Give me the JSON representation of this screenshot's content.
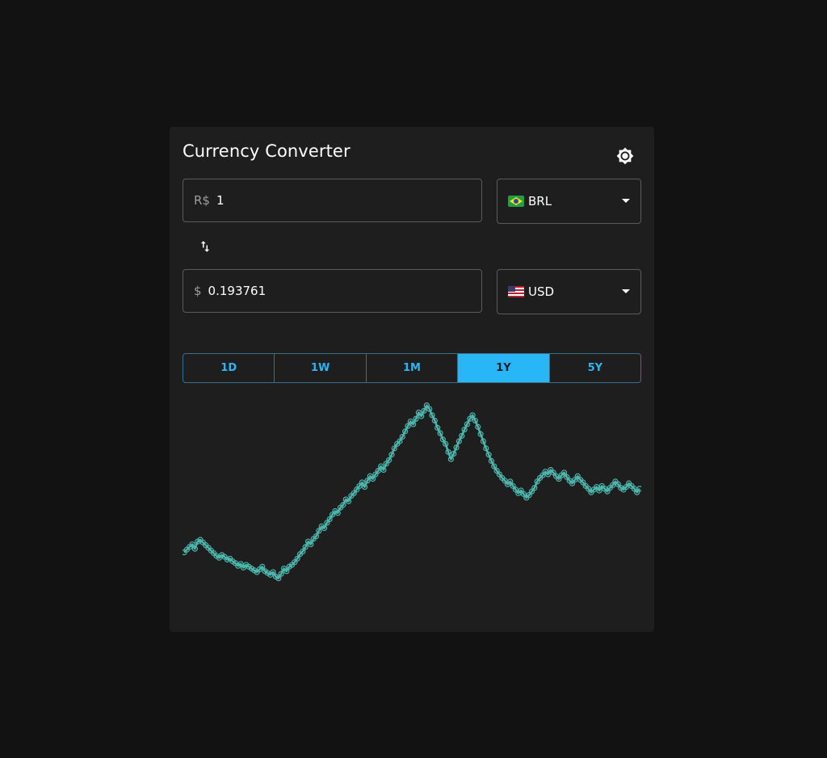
{
  "app": {
    "title": "Currency Converter",
    "theme_toggle_icon": "brightness-icon"
  },
  "from": {
    "symbol": "R$",
    "amount": "1",
    "currency": "BRL",
    "flag": "brazil-flag-icon"
  },
  "to": {
    "symbol": "$",
    "amount": "0.193761",
    "currency": "USD",
    "flag": "us-flag-icon"
  },
  "swap_icon": "swap-vertical-icon",
  "range_tabs": [
    {
      "label": "1D",
      "active": false
    },
    {
      "label": "1W",
      "active": false
    },
    {
      "label": "1M",
      "active": false
    },
    {
      "label": "1Y",
      "active": true
    },
    {
      "label": "5Y",
      "active": false
    }
  ],
  "colors": {
    "accent": "#29b6f6",
    "line": "#4db6ac",
    "background": "#121212",
    "card": "#1e1e1e"
  },
  "chart_data": {
    "type": "line",
    "series": [
      {
        "values": [
          0.1766,
          0.1769,
          0.1772,
          0.1775,
          0.177,
          0.1778,
          0.178,
          0.1777,
          0.1774,
          0.1771,
          0.1768,
          0.1765,
          0.1762,
          0.176,
          0.1763,
          0.1761,
          0.1758,
          0.1759,
          0.1756,
          0.1754,
          0.1751,
          0.1753,
          0.1749,
          0.1752,
          0.175,
          0.1748,
          0.1746,
          0.1744,
          0.1747,
          0.175,
          0.1745,
          0.1743,
          0.1741,
          0.1744,
          0.1739,
          0.1737,
          0.1742,
          0.1748,
          0.1745,
          0.175,
          0.1752,
          0.1755,
          0.1759,
          0.1764,
          0.1767,
          0.1772,
          0.1778,
          0.1775,
          0.1781,
          0.1784,
          0.179,
          0.1795,
          0.1793,
          0.1799,
          0.1803,
          0.1808,
          0.1812,
          0.181,
          0.1816,
          0.1819,
          0.1825,
          0.1823,
          0.1829,
          0.1832,
          0.1836,
          0.184,
          0.1844,
          0.1839,
          0.1846,
          0.1851,
          0.1848,
          0.1853,
          0.1857,
          0.1862,
          0.1858,
          0.1865,
          0.1869,
          0.1875,
          0.1882,
          0.1887,
          0.189,
          0.1895,
          0.1901,
          0.1907,
          0.1912,
          0.1909,
          0.1915,
          0.1922,
          0.1918,
          0.1924,
          0.193,
          0.1926,
          0.1919,
          0.1913,
          0.1905,
          0.1899,
          0.1892,
          0.1887,
          0.1878,
          0.187,
          0.1876,
          0.1883,
          0.189,
          0.1896,
          0.1903,
          0.1909,
          0.1915,
          0.1919,
          0.1913,
          0.1906,
          0.1898,
          0.189,
          0.1882,
          0.1875,
          0.1868,
          0.1862,
          0.1857,
          0.1853,
          0.1849,
          0.1846,
          0.1842,
          0.1845,
          0.184,
          0.1836,
          0.1832,
          0.1835,
          0.1831,
          0.1827,
          0.183,
          0.1834,
          0.1838,
          0.1845,
          0.1849,
          0.1852,
          0.1856,
          0.1853,
          0.1858,
          0.1855,
          0.1851,
          0.1848,
          0.1852,
          0.1855,
          0.185,
          0.1846,
          0.1843,
          0.1847,
          0.1851,
          0.1847,
          0.1844,
          0.184,
          0.1837,
          0.1833,
          0.1836,
          0.1839,
          0.1835,
          0.184,
          0.1837,
          0.1834,
          0.1838,
          0.1841,
          0.1845,
          0.1842,
          0.1838,
          0.1836,
          0.1839,
          0.1843,
          0.184,
          0.1837,
          0.1833,
          0.1837
        ]
      }
    ],
    "ylim": [
      0.1725,
      0.1945
    ],
    "grid": false,
    "legend": "none"
  }
}
